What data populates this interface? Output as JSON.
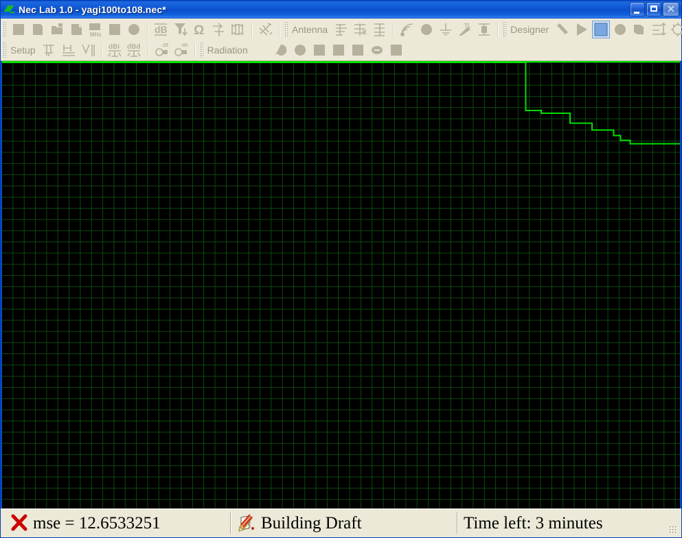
{
  "window": {
    "title": "Nec Lab 1.0 - yagi100to108.nec*",
    "app_icon": "nec-lab-icon",
    "buttons": {
      "minimize": "_",
      "maximize": "□",
      "close": "✕"
    }
  },
  "toolbar": {
    "row1": {
      "group_file": [
        {
          "name": "new-document-button",
          "icon": "square-icon"
        },
        {
          "name": "open-document-button",
          "icon": "page-icon"
        },
        {
          "name": "open-folder-button",
          "icon": "folder-icon"
        },
        {
          "name": "save-document-button",
          "icon": "save-icon"
        },
        {
          "name": "frequency-mhz-button",
          "icon": "mhz-icon",
          "label": "MHz"
        },
        {
          "name": "geometry-button",
          "icon": "square-icon"
        },
        {
          "name": "ground-plane-button",
          "icon": "circle-icon"
        }
      ],
      "group_plots": [
        {
          "name": "gain-db-button",
          "icon": "db-icon",
          "label": "dB"
        },
        {
          "name": "swr-chart-button",
          "icon": "bar-chart-icon"
        },
        {
          "name": "impedance-ohm-button",
          "icon": "omega-icon",
          "label": "Ω"
        },
        {
          "name": "current-distribution-button",
          "icon": "current-icon"
        },
        {
          "name": "smith-chart-button",
          "icon": "smith-chart-icon"
        }
      ],
      "group_misc": [
        {
          "name": "optimize-button",
          "icon": "optimize-icon"
        }
      ],
      "antenna_label": "Antenna",
      "group_antenna_types": [
        {
          "name": "antenna-yagi-button",
          "icon": "yagi-icon"
        },
        {
          "name": "antenna-log-periodic-button",
          "icon": "log-periodic-icon"
        },
        {
          "name": "antenna-array-button",
          "icon": "array-icon"
        }
      ],
      "group_antenna_elements": [
        {
          "name": "antenna-radiation-button",
          "icon": "radiation-waves-icon"
        },
        {
          "name": "antenna-sphere-button",
          "icon": "filled-circle-icon"
        },
        {
          "name": "antenna-ground-button",
          "icon": "ground-symbol-icon"
        },
        {
          "name": "antenna-transmission-line-button",
          "icon": "tl-icon",
          "label": "TL"
        },
        {
          "name": "antenna-balun-button",
          "icon": "balun-icon"
        }
      ],
      "designer_label": "Designer",
      "group_designer": [
        {
          "name": "designer-wire-button",
          "icon": "diagonal-wire-icon",
          "selected": false
        },
        {
          "name": "designer-run-button",
          "icon": "play-triangle-icon",
          "selected": false
        },
        {
          "name": "designer-plane-button",
          "icon": "square-icon",
          "selected": true
        },
        {
          "name": "designer-disc-button",
          "icon": "circle-icon",
          "selected": false
        },
        {
          "name": "designer-box-button",
          "icon": "box-icon",
          "selected": false
        },
        {
          "name": "designer-arrange-button",
          "icon": "arrange-icon",
          "selected": false
        },
        {
          "name": "designer-settings-button",
          "icon": "gear-icon",
          "selected": false
        }
      ]
    },
    "row2": {
      "setup_label": "Setup",
      "group_setup": [
        {
          "name": "setup-vertical-pattern-button",
          "icon": "t-antenna-icon"
        },
        {
          "name": "setup-horizontal-pattern-button",
          "icon": "h-antenna-icon"
        },
        {
          "name": "setup-vertical-bars-button",
          "icon": "v-bars-icon"
        }
      ],
      "group_gain_units": [
        {
          "name": "gain-dbi-button",
          "icon": "dbi-icon",
          "label": "dBi"
        },
        {
          "name": "gain-dbd-button",
          "icon": "dbd-icon",
          "label": "dBd"
        }
      ],
      "group_sidelobe": [
        {
          "name": "sidelobe-25db-button",
          "icon": "pattern-25-icon",
          "label": "-25"
        },
        {
          "name": "sidelobe-40db-button",
          "icon": "pattern-40-icon",
          "label": "-40"
        }
      ],
      "radiation_label": "Radiation",
      "group_radiation": [
        {
          "name": "radiation-pattern-1-button",
          "icon": "lobe-icon"
        },
        {
          "name": "radiation-pattern-2-button",
          "icon": "lobe-tail-icon"
        },
        {
          "name": "radiation-pattern-3-button",
          "icon": "lobe-round-icon"
        },
        {
          "name": "radiation-plot-1-button",
          "icon": "square-icon"
        },
        {
          "name": "radiation-plot-2-button",
          "icon": "square-icon"
        },
        {
          "name": "radiation-plot-3-button",
          "icon": "square-icon"
        },
        {
          "name": "radiation-minus-button",
          "icon": "minus-circle-icon"
        },
        {
          "name": "radiation-plot-4-button",
          "icon": "square-icon"
        }
      ]
    }
  },
  "statusbar": {
    "mse_icon": "red-x-icon",
    "mse_text": "mse = 12.6533251",
    "state_icon": "pencil-draft-icon",
    "state_text": "Building Draft",
    "time_text": "Time left:  3 minutes"
  },
  "chart_data": {
    "type": "line",
    "title": "",
    "xlabel": "",
    "ylabel": "",
    "grid": true,
    "legend": null,
    "background_color": "#000000",
    "grid_color": "#0d4a0d",
    "series_color": "#00e000",
    "description": "Optimizer convergence: step-wise monotonically decreasing mean-squared-error curve, flat at the maximum until the first improvement near the right edge of the plot.",
    "x_range": [
      0,
      993
    ],
    "y_range": [
      0,
      650
    ],
    "points": [
      [
        0,
        2
      ],
      [
        767,
        2
      ],
      [
        767,
        68
      ],
      [
        767,
        72
      ],
      [
        790,
        72
      ],
      [
        790,
        76
      ],
      [
        832,
        76
      ],
      [
        832,
        90
      ],
      [
        864,
        90
      ],
      [
        864,
        100
      ],
      [
        896,
        100
      ],
      [
        896,
        108
      ],
      [
        906,
        108
      ],
      [
        906,
        115
      ],
      [
        920,
        115
      ],
      [
        920,
        120
      ],
      [
        940,
        120
      ],
      [
        993,
        120
      ]
    ]
  }
}
